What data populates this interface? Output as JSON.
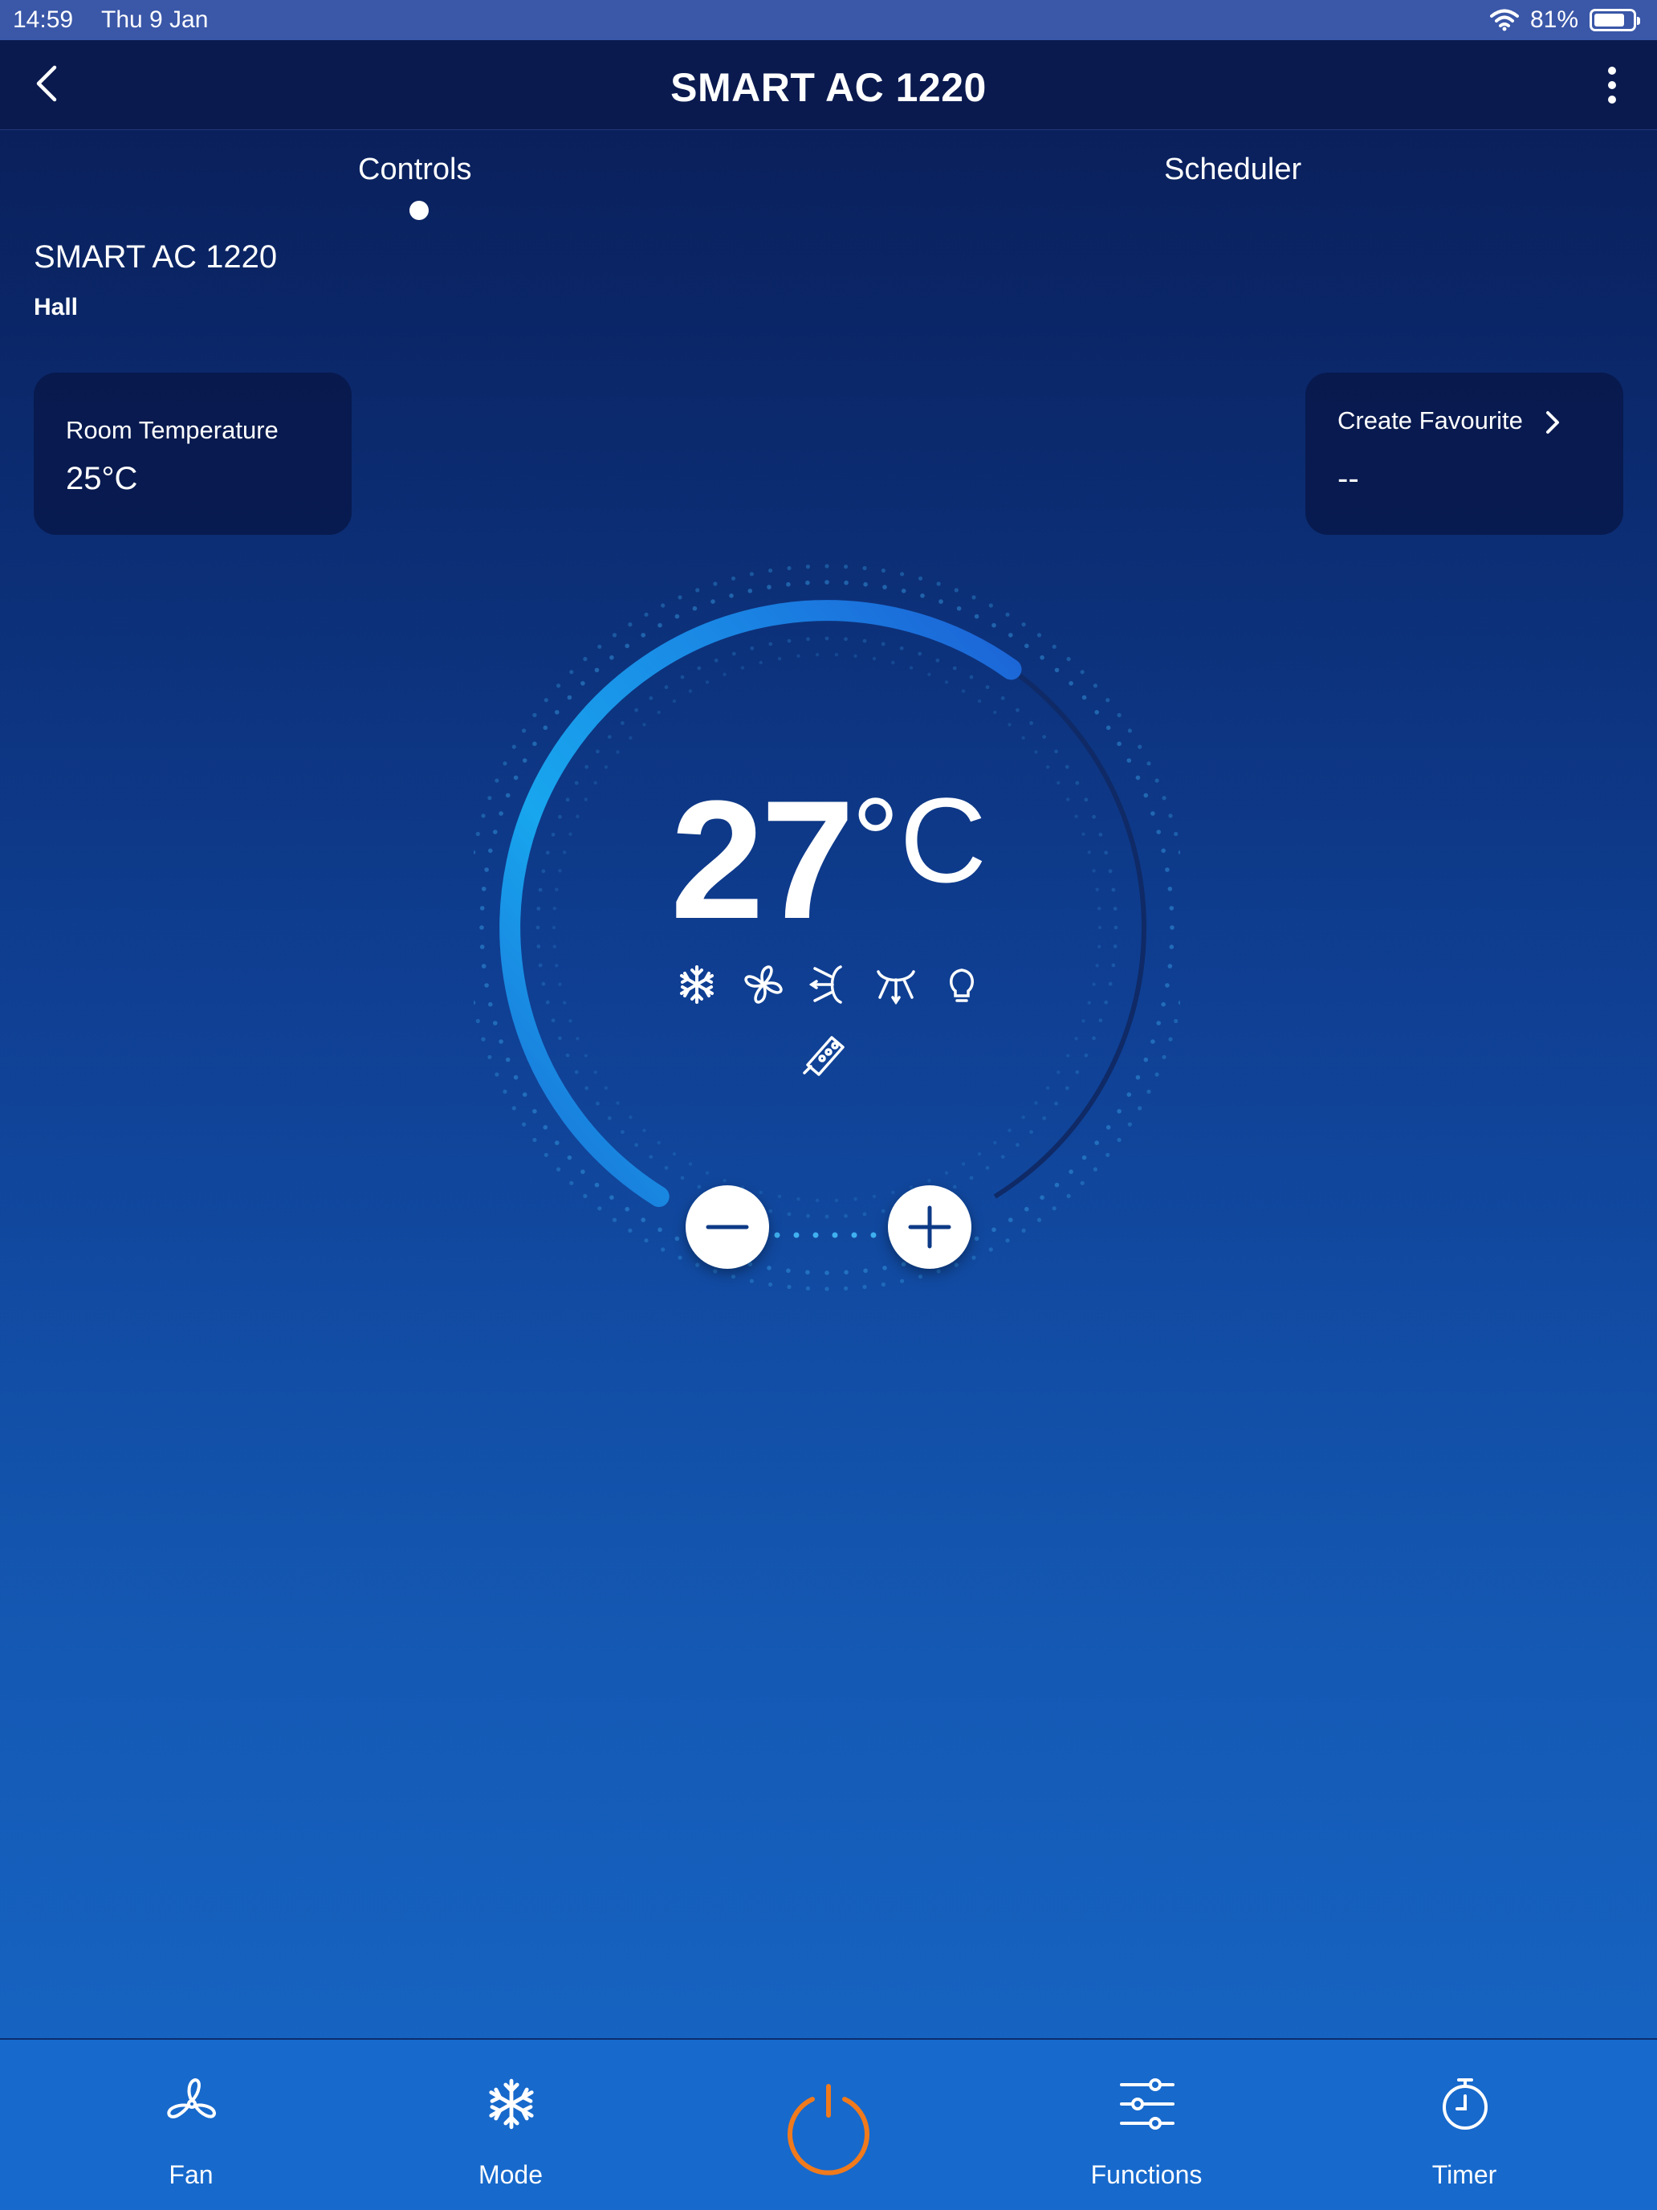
{
  "status_bar": {
    "time": "14:59",
    "date": "Thu 9 Jan",
    "battery": "81%",
    "battery_level": 0.81,
    "icons": [
      "wifi-icon",
      "battery-icon"
    ]
  },
  "navbar": {
    "title": "SMART AC 1220",
    "icons": [
      "back-chevron-icon",
      "more-vertical-icon"
    ]
  },
  "tabs": [
    {
      "label": "Controls",
      "active": true
    },
    {
      "label": "Scheduler",
      "active": false
    }
  ],
  "device": {
    "name": "SMART AC 1220",
    "room": "Hall"
  },
  "room_temperature": {
    "label": "Room Temperature",
    "value": "25°C"
  },
  "favourite": {
    "label": "Create Favourite",
    "value": "--"
  },
  "thermostat": {
    "set_value": "27",
    "unit": "°C",
    "dial_fill_fraction": 0.62,
    "mode_icons": [
      "snowflake-icon",
      "fan-icon",
      "swing-horizontal-icon",
      "swing-vertical-icon",
      "light-bulb-icon",
      "eco-icon"
    ]
  },
  "bottom_nav": {
    "fan": "Fan",
    "mode": "Mode",
    "functions": "Functions",
    "timer": "Timer",
    "power_color": "#f07a1c"
  },
  "colors": {
    "arc_start": "#1ab2f2",
    "arc_end": "#1a68d8",
    "power": "#f07a1c",
    "card_bg": "#0a1a4f"
  }
}
